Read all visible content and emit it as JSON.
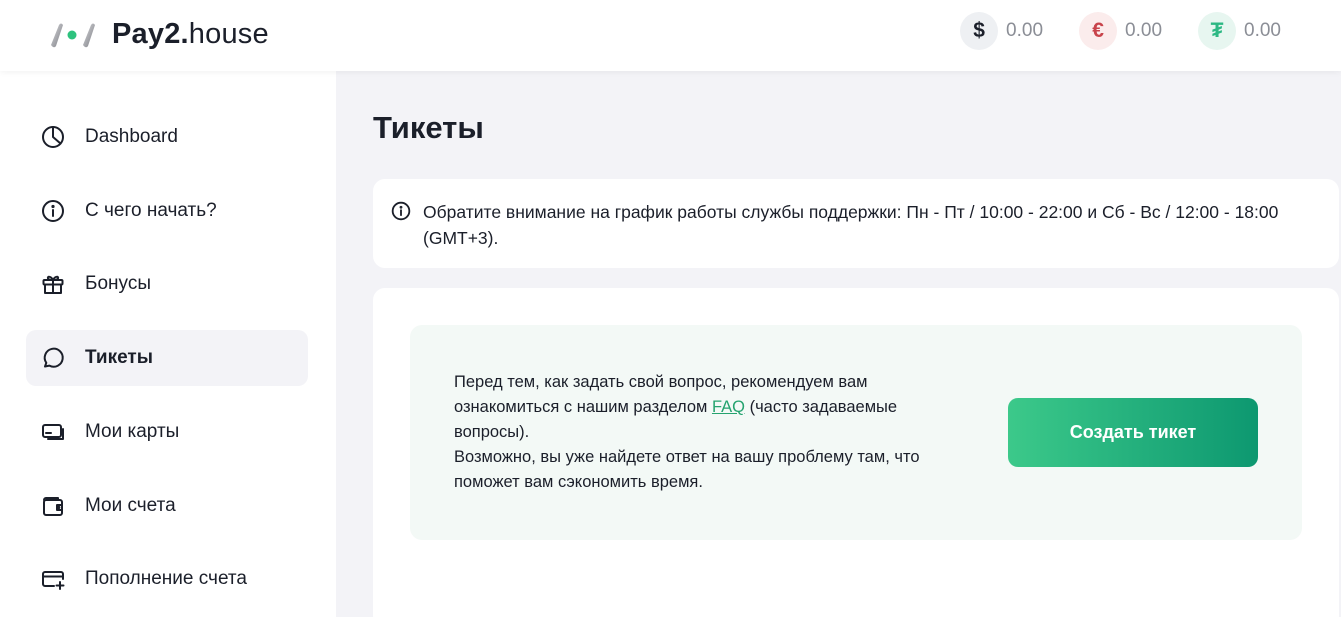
{
  "header": {
    "logo_bold": "Pay2.",
    "logo_light": "house",
    "balances": [
      {
        "symbol": "$",
        "value": "0.00",
        "icon": "dollar-icon",
        "color": "#1b1f2a"
      },
      {
        "symbol": "€",
        "value": "0.00",
        "icon": "euro-icon",
        "color": "#c8434b"
      },
      {
        "symbol": "₮",
        "value": "0.00",
        "icon": "tether-icon",
        "color": "#2db884"
      }
    ]
  },
  "sidebar": {
    "items": [
      {
        "label": "Dashboard",
        "icon": "pie-chart-icon",
        "active": false
      },
      {
        "label": "С чего начать?",
        "icon": "info-icon",
        "active": false
      },
      {
        "label": "Бонусы",
        "icon": "gift-icon",
        "active": false
      },
      {
        "label": "Тикеты",
        "icon": "chat-bubble-icon",
        "active": true
      },
      {
        "label": "Мои карты",
        "icon": "cards-icon",
        "active": false
      },
      {
        "label": "Мои счета",
        "icon": "wallet-icon",
        "active": false
      },
      {
        "label": "Пополнение счета",
        "icon": "add-card-icon",
        "active": false
      }
    ]
  },
  "main": {
    "title": "Тикеты",
    "notice": "Обратите внимание на график работы службы поддержки: Пн - Пт / 10:00 - 22:00 и Сб - Вс / 12:00 - 18:00 (GMT+3).",
    "info": {
      "text_before_link": "Перед тем, как задать свой вопрос, рекомендуем вам ознакомиться с нашим разделом ",
      "link": "FAQ",
      "text_after_link": " (часто задаваемые вопросы).",
      "text_second": "Возможно, вы уже найдете ответ на вашу проблему там, что поможет вам сэкономить время."
    },
    "create_button": "Создать тикет"
  },
  "colors": {
    "accent": "#25a36f",
    "button_gradient_start": "#3cc98a",
    "button_gradient_end": "#0d9870",
    "background": "#f3f3f7"
  }
}
